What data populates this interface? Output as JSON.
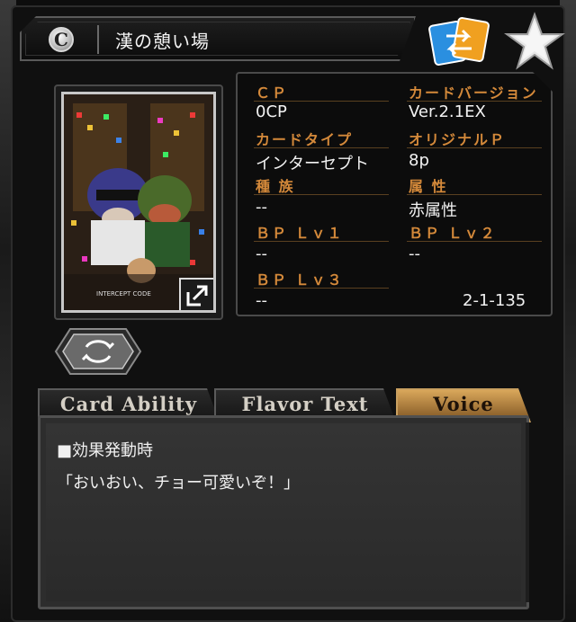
{
  "header": {
    "rarity": "C",
    "card_name": "漢の憩い場",
    "swap_icon": "swap-cards-icon",
    "favorite_icon": "star-icon"
  },
  "card_image": {
    "code_text": "INTERCEPT CODE",
    "expand_icon": "expand-external-icon"
  },
  "refresh_icon": "refresh-icon",
  "info": {
    "cp_label": "ＣＰ",
    "cp_value": "0CP",
    "version_label": "カードバージョン",
    "version_value": "Ver.2.1EX",
    "type_label": "カードタイプ",
    "type_value": "インターセプト",
    "original_label": "オリジナルＰ",
    "original_value": "8p",
    "race_label": "種 族",
    "race_value": "--",
    "attr_label": "属 性",
    "attr_value": "赤属性",
    "bp1_label": "ＢＰ Ｌｖ１",
    "bp1_value": "--",
    "bp2_label": "ＢＰ Ｌｖ２",
    "bp2_value": "--",
    "bp3_label": "ＢＰ Ｌｖ３",
    "bp3_value": "--",
    "card_number": "2-1-135"
  },
  "tabs": [
    {
      "label": "Card Ability",
      "active": false
    },
    {
      "label": "Flavor Text",
      "active": false
    },
    {
      "label": "Voice",
      "active": true
    }
  ],
  "voice": {
    "line1": "■効果発動時",
    "line2": "「おいおい、チョー可愛いぞ！」"
  },
  "colors": {
    "label_orange": "#d4893a",
    "active_tab_gold": "#d9a75a",
    "swap_blue": "#2a8fe0",
    "swap_orange": "#f0a020"
  }
}
